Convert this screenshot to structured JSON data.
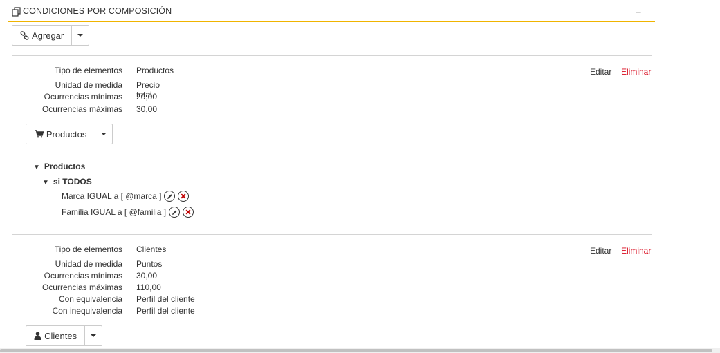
{
  "panel": {
    "title": "CONDICIONES POR COMPOSICIÓN",
    "collapse_label": "–"
  },
  "toolbar": {
    "add_label": "Agregar"
  },
  "conditions": [
    {
      "properties": [
        {
          "label": "Tipo de elementos",
          "value": "Productos"
        },
        {
          "label": "Unidad de medida",
          "value": "Precio total"
        },
        {
          "label": "Ocurrencias mínimas",
          "value": "20,00"
        },
        {
          "label": "Ocurrencias máximas",
          "value": "30,00"
        }
      ],
      "edit_label": "Editar",
      "delete_label": "Eliminar",
      "button_label": "Productos",
      "button_icon": "cart-icon",
      "tree": {
        "root_label": "Productos",
        "group_label": "si TODOS",
        "items": [
          {
            "text": "Marca IGUAL a [ @marca ]"
          },
          {
            "text": "Familia IGUAL a [ @familia ]"
          }
        ]
      }
    },
    {
      "properties": [
        {
          "label": "Tipo de elementos",
          "value": "Clientes"
        },
        {
          "label": "Unidad de medida",
          "value": "Puntos"
        },
        {
          "label": "Ocurrencias mínimas",
          "value": "30,00"
        },
        {
          "label": "Ocurrencias máximas",
          "value": "110,00"
        },
        {
          "label": "Con equivalencia",
          "value": "Perfil del cliente"
        },
        {
          "label": "Con inequivalencia",
          "value": "Perfil del cliente"
        }
      ],
      "edit_label": "Editar",
      "delete_label": "Eliminar",
      "button_label": "Clientes",
      "button_icon": "user-icon"
    }
  ],
  "colors": {
    "accent": "#f0b400",
    "delete": "#d9091c",
    "remove_icon": "#c00000"
  }
}
